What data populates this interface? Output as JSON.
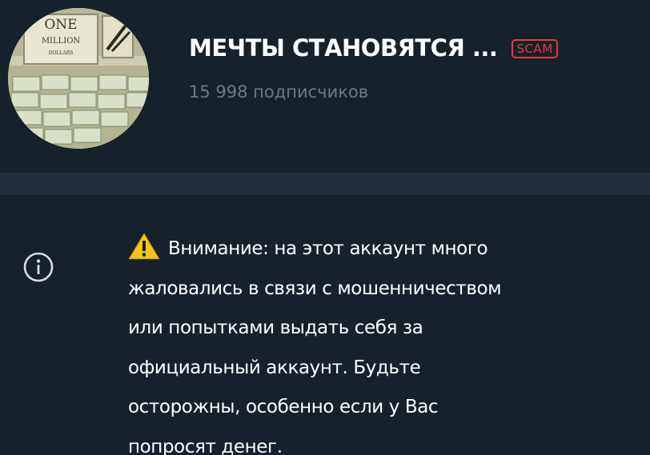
{
  "channel": {
    "title": "МЕЧТЫ СТАНОВЯТСЯ ...",
    "badge": "SCAM",
    "subscribers": "15 998 подписчиков",
    "avatar_text": [
      "ONE",
      "MILLION",
      "DOLLARS"
    ]
  },
  "info": {
    "warning_lines": [
      "Внимание: на этот аккаунт много",
      "жаловались в связи с мошенничеством",
      "или попытками выдать себя за",
      "официальный аккаунт. Будьте",
      "осторожны, особенно если у Вас",
      "попросят денег."
    ]
  },
  "icons": {
    "info": "info-icon",
    "warning": "warning-icon"
  },
  "colors": {
    "background": "#17212b",
    "divider": "#232e3c",
    "text": "#ffffff",
    "muted": "#6d7883",
    "scam": "#e53935",
    "warning_yellow": "#f5c518"
  }
}
